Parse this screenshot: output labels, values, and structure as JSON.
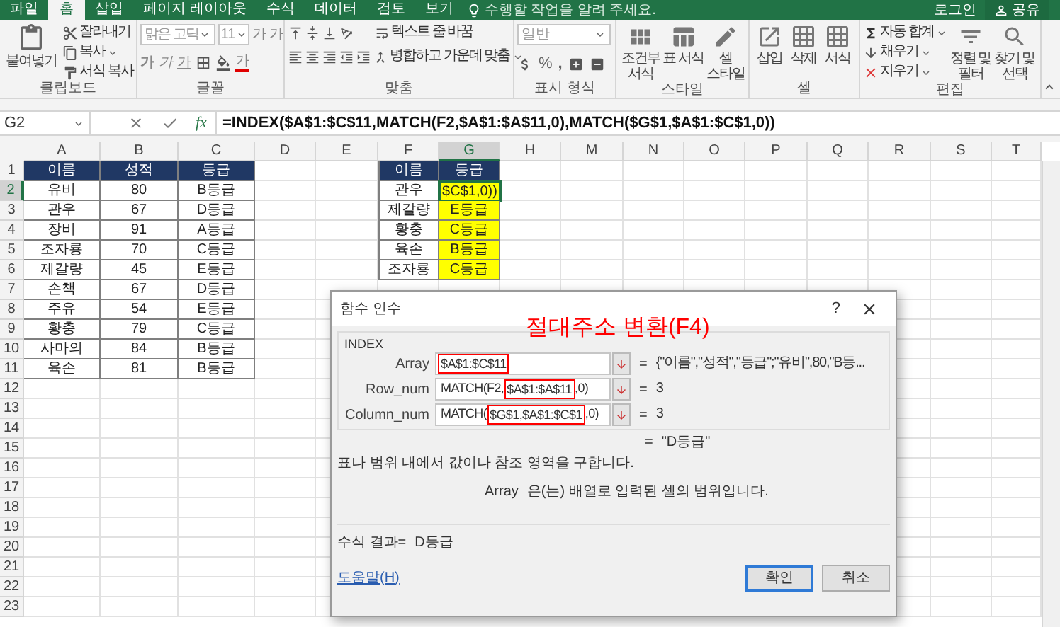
{
  "menu_tabs": [
    {
      "label": "파일",
      "selected": false
    },
    {
      "label": "홈",
      "selected": true
    },
    {
      "label": "삽입",
      "selected": false
    },
    {
      "label": "페이지 레이아웃",
      "selected": false
    },
    {
      "label": "수식",
      "selected": false
    },
    {
      "label": "데이터",
      "selected": false
    },
    {
      "label": "검토",
      "selected": false
    },
    {
      "label": "보기",
      "selected": false
    }
  ],
  "tell_me": {
    "placeholder": "수행할 작업을 알려 주세요."
  },
  "account": {
    "sign_in": "로그인",
    "share": "공유"
  },
  "ribbon": [
    {
      "kind": "clipboard",
      "label": "클립보드",
      "paste": "붙여넣기",
      "cut": "잘라내기",
      "copy": "복사",
      "format_painter": "서식 복사"
    },
    {
      "kind": "font",
      "label": "글꼴",
      "font_name": "맑은 고딕",
      "font_size": "11",
      "grow": "가",
      "shrink": "가",
      "bold": "가",
      "italic": "가",
      "underline": "가",
      "font_color": "가"
    },
    {
      "kind": "alignment",
      "label": "맞춤",
      "wrap_text": "텍스트 줄 바꿈",
      "merge": "병합하고 가운데 맞춤"
    },
    {
      "kind": "number",
      "label": "표시 형식",
      "format": "일반",
      "percent": "%",
      "comma": ","
    },
    {
      "kind": "styles",
      "label": "스타일",
      "buttons": [
        "조건부 서식",
        "표 서식",
        "셀 스타일"
      ]
    },
    {
      "kind": "cells",
      "label": "셀",
      "buttons": [
        "삽입",
        "삭제",
        "서식"
      ]
    },
    {
      "kind": "editing",
      "label": "편집",
      "autosum": "자동 합계",
      "fill": "채우기",
      "clear": "지우기",
      "sort": "정렬 및 필터",
      "find": "찾기 및 선택"
    }
  ],
  "formula_bar": {
    "name_box": "G2",
    "function_button": "fx",
    "formula": "=INDEX($A$1:$C$11,MATCH(F2,$A$1:$A$11,0),MATCH($G$1,$A$1:$C$1,0))"
  },
  "sheet": {
    "columns": [
      {
        "label": "A",
        "selected": false
      },
      {
        "label": "B",
        "selected": false
      },
      {
        "label": "C",
        "selected": false
      },
      {
        "label": "D",
        "selected": false
      },
      {
        "label": "E",
        "selected": false
      },
      {
        "label": "F",
        "selected": false
      },
      {
        "label": "G",
        "selected": true
      },
      {
        "label": "H",
        "selected": false
      },
      {
        "label": "M",
        "selected": false
      },
      {
        "label": "N",
        "selected": false
      },
      {
        "label": "O",
        "selected": false
      },
      {
        "label": "P",
        "selected": false
      },
      {
        "label": "Q",
        "selected": false
      },
      {
        "label": "R",
        "selected": false
      },
      {
        "label": "S",
        "selected": false
      },
      {
        "label": "T",
        "selected": false
      }
    ],
    "rows": [
      {
        "label": "1",
        "selected": false,
        "cells": [
          {
            "kind": "header",
            "text": "이름"
          },
          {
            "kind": "header",
            "text": "성적"
          },
          {
            "kind": "header",
            "text": "등급"
          },
          {
            "kind": "empty"
          },
          {
            "kind": "empty"
          },
          {
            "kind": "header",
            "text": "이름"
          },
          {
            "kind": "header",
            "text": "등급"
          }
        ]
      },
      {
        "label": "2",
        "selected": true,
        "cells": [
          {
            "kind": "data",
            "text": "유비"
          },
          {
            "kind": "data",
            "text": "80"
          },
          {
            "kind": "data",
            "text": "B등급"
          },
          {
            "kind": "empty"
          },
          {
            "kind": "empty"
          },
          {
            "kind": "data",
            "text": "관우"
          },
          {
            "kind": "editing",
            "text": "$C$1,0))"
          }
        ]
      },
      {
        "label": "3",
        "selected": false,
        "cells": [
          {
            "kind": "data",
            "text": "관우"
          },
          {
            "kind": "data",
            "text": "67"
          },
          {
            "kind": "data",
            "text": "D등급"
          },
          {
            "kind": "empty"
          },
          {
            "kind": "empty"
          },
          {
            "kind": "data",
            "text": "제갈량"
          },
          {
            "kind": "highlight",
            "text": "E등급"
          }
        ]
      },
      {
        "label": "4",
        "selected": false,
        "cells": [
          {
            "kind": "data",
            "text": "장비"
          },
          {
            "kind": "data",
            "text": "91"
          },
          {
            "kind": "data",
            "text": "A등급"
          },
          {
            "kind": "empty"
          },
          {
            "kind": "empty"
          },
          {
            "kind": "data",
            "text": "황충"
          },
          {
            "kind": "highlight",
            "text": "C등급"
          }
        ]
      },
      {
        "label": "5",
        "selected": false,
        "cells": [
          {
            "kind": "data",
            "text": "조자룡"
          },
          {
            "kind": "data",
            "text": "70"
          },
          {
            "kind": "data",
            "text": "C등급"
          },
          {
            "kind": "empty"
          },
          {
            "kind": "empty"
          },
          {
            "kind": "data",
            "text": "육손"
          },
          {
            "kind": "highlight",
            "text": "B등급"
          }
        ]
      },
      {
        "label": "6",
        "selected": false,
        "cells": [
          {
            "kind": "data",
            "text": "제갈량"
          },
          {
            "kind": "data",
            "text": "45"
          },
          {
            "kind": "data",
            "text": "E등급"
          },
          {
            "kind": "empty"
          },
          {
            "kind": "empty"
          },
          {
            "kind": "data",
            "text": "조자룡"
          },
          {
            "kind": "highlight",
            "text": "C등급"
          }
        ]
      },
      {
        "label": "7",
        "selected": false,
        "cells": [
          {
            "kind": "data",
            "text": "손책"
          },
          {
            "kind": "data",
            "text": "67"
          },
          {
            "kind": "data",
            "text": "D등급"
          }
        ]
      },
      {
        "label": "8",
        "selected": false,
        "cells": [
          {
            "kind": "data",
            "text": "주유"
          },
          {
            "kind": "data",
            "text": "54"
          },
          {
            "kind": "data",
            "text": "E등급"
          }
        ]
      },
      {
        "label": "9",
        "selected": false,
        "cells": [
          {
            "kind": "data",
            "text": "황충"
          },
          {
            "kind": "data",
            "text": "79"
          },
          {
            "kind": "data",
            "text": "C등급"
          }
        ]
      },
      {
        "label": "10",
        "selected": false,
        "cells": [
          {
            "kind": "data",
            "text": "사마의"
          },
          {
            "kind": "data",
            "text": "84"
          },
          {
            "kind": "data",
            "text": "B등급"
          }
        ]
      },
      {
        "label": "11",
        "selected": false,
        "cells": [
          {
            "kind": "data",
            "text": "육손"
          },
          {
            "kind": "data",
            "text": "81"
          },
          {
            "kind": "data",
            "text": "B등급"
          }
        ]
      },
      {
        "label": "12",
        "selected": false,
        "cells": []
      },
      {
        "label": "13",
        "selected": false,
        "cells": []
      },
      {
        "label": "14",
        "selected": false,
        "cells": []
      },
      {
        "label": "15",
        "selected": false,
        "cells": []
      },
      {
        "label": "16",
        "selected": false,
        "cells": []
      },
      {
        "label": "17",
        "selected": false,
        "cells": []
      },
      {
        "label": "18",
        "selected": false,
        "cells": []
      },
      {
        "label": "19",
        "selected": false,
        "cells": []
      },
      {
        "label": "20",
        "selected": false,
        "cells": []
      },
      {
        "label": "21",
        "selected": false,
        "cells": []
      },
      {
        "label": "22",
        "selected": false,
        "cells": []
      },
      {
        "label": "23",
        "selected": false,
        "cells": []
      }
    ]
  },
  "dialog": {
    "title": "함수 인수",
    "help": "?",
    "annotation": "절대주소 변환(F4)",
    "function": "INDEX",
    "arguments": [
      {
        "label": "Array",
        "segments": [
          {
            "text": "$A$1:$C$11",
            "marked": true
          }
        ],
        "equals": "=",
        "result": "{\"이름\",\"성적\",\"등급\";\"유비\",80,\"B등..."
      },
      {
        "label": "Row_num",
        "segments": [
          {
            "text": "MATCH(F2,",
            "marked": false
          },
          {
            "text": "$A$1:$A$11",
            "marked": true
          },
          {
            "text": ",0)",
            "marked": false
          }
        ],
        "equals": "=",
        "result": "3"
      },
      {
        "label": "Column_num",
        "segments": [
          {
            "text": "MATCH(",
            "marked": false
          },
          {
            "text": "$G$1,$A$1:$C$1",
            "marked": true
          },
          {
            "text": ",0)",
            "marked": false
          }
        ],
        "equals": "=",
        "result": "3"
      }
    ],
    "result": {
      "equals": "=",
      "value": "\"D등급\""
    },
    "description": "표나 범위 내에서 값이나 참조 영역을 구합니다.",
    "argument_help": {
      "name": "Array",
      "text": "은(는) 배열로 입력된 셀의 범위입니다."
    },
    "formula_result": {
      "label": "수식 결과=",
      "value": "D등급"
    },
    "help_link": "도움말(H)",
    "buttons": [
      {
        "label": "확인",
        "default": true
      },
      {
        "label": "취소",
        "default": false
      }
    ]
  }
}
